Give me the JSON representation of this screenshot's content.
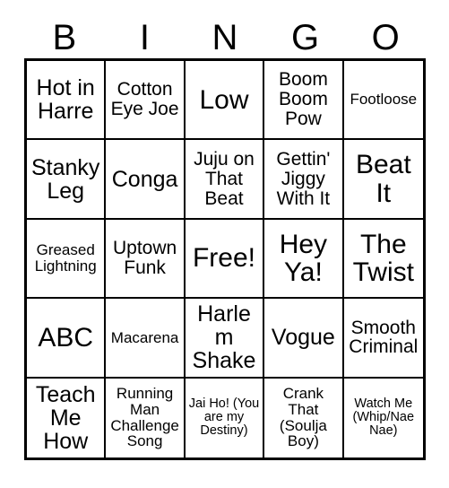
{
  "card": {
    "title_letters": [
      "B",
      "I",
      "N",
      "G",
      "O"
    ],
    "columns": 5,
    "rows": 5,
    "border_color": "#000000",
    "background_color": "#ffffff",
    "text_color": "#000000",
    "cells": [
      {
        "text": "Hot in Harre",
        "size": "fs-lg",
        "free": false
      },
      {
        "text": "Cotton Eye Joe",
        "size": "fs-md",
        "free": false
      },
      {
        "text": "Low",
        "size": "fs-xl",
        "free": false
      },
      {
        "text": "Boom Boom Pow",
        "size": "fs-md",
        "free": false
      },
      {
        "text": "Footloose",
        "size": "fs-sm",
        "free": false
      },
      {
        "text": "Stanky Leg",
        "size": "fs-lg",
        "free": false
      },
      {
        "text": "Conga",
        "size": "fs-lg",
        "free": false
      },
      {
        "text": "Juju on That Beat",
        "size": "fs-md",
        "free": false
      },
      {
        "text": "Gettin' Jiggy With It",
        "size": "fs-md",
        "free": false
      },
      {
        "text": "Beat It",
        "size": "fs-xl",
        "free": false
      },
      {
        "text": "Greased Lightning",
        "size": "fs-sm",
        "free": false
      },
      {
        "text": "Uptown Funk",
        "size": "fs-md",
        "free": false
      },
      {
        "text": "Free!",
        "size": "fs-xl",
        "free": true
      },
      {
        "text": "Hey Ya!",
        "size": "fs-xl",
        "free": false
      },
      {
        "text": "The Twist",
        "size": "fs-xl",
        "free": false
      },
      {
        "text": "ABC",
        "size": "fs-xl",
        "free": false
      },
      {
        "text": "Macarena",
        "size": "fs-sm",
        "free": false
      },
      {
        "text": "Harlem Shake",
        "size": "fs-lg",
        "free": false
      },
      {
        "text": "Vogue",
        "size": "fs-lg",
        "free": false
      },
      {
        "text": "Smooth Criminal",
        "size": "fs-md",
        "free": false
      },
      {
        "text": "Teach Me How",
        "size": "fs-lg",
        "free": false
      },
      {
        "text": "Running Man Challenge Song",
        "size": "fs-sm",
        "free": false
      },
      {
        "text": "Jai Ho! (You are my Destiny)",
        "size": "fs-xs",
        "free": false
      },
      {
        "text": "Crank That (Soulja Boy)",
        "size": "fs-sm",
        "free": false
      },
      {
        "text": "Watch Me (Whip/Nae Nae)",
        "size": "fs-xs",
        "free": false
      }
    ]
  }
}
